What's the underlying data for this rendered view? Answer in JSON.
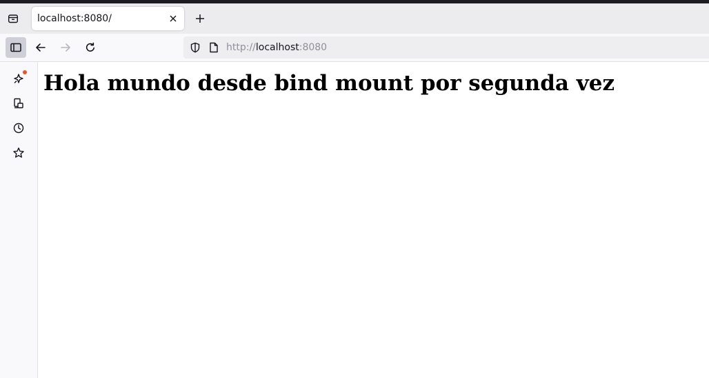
{
  "tab": {
    "title": "localhost:8080/"
  },
  "urlbar": {
    "scheme": "http://",
    "host": "localhost",
    "port": ":8080"
  },
  "page": {
    "heading": "Hola mundo desde bind mount por segunda vez"
  },
  "icons": {
    "tab_list": "tab-list-icon",
    "close": "close-icon",
    "new_tab": "plus-icon",
    "sidebar_toggle": "sidebar-icon",
    "back": "arrow-left-icon",
    "forward": "arrow-right-icon",
    "reload": "reload-icon",
    "tracking_protection": "shield-icon",
    "page_info": "page-icon",
    "ai_chatbot": "sparkle-icon",
    "synced_tabs": "devices-icon",
    "history": "clock-icon",
    "bookmarks": "star-icon"
  },
  "colors": {
    "notification_dot": "#e8542a",
    "sidebar_toggle_active": "#cfcfd8"
  }
}
